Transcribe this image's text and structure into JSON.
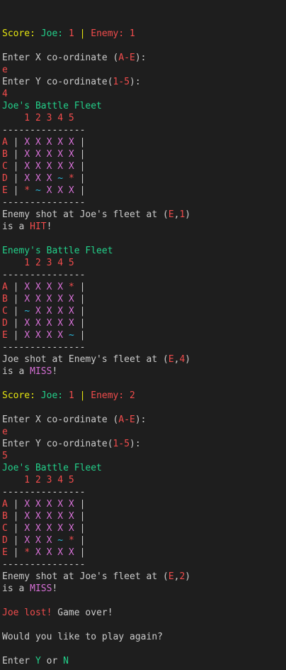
{
  "colors": {
    "default": "#cccccc",
    "yellow": "#e5e510",
    "green": "#23d18b",
    "red": "#f14c4c",
    "magenta": "#d670d6",
    "cyan": "#29b8db",
    "background": "#1e1e1e"
  },
  "lines": [
    [
      [
        "Score: ",
        "yellow"
      ],
      [
        "Joe: ",
        "green"
      ],
      [
        "1",
        "red"
      ],
      [
        " | ",
        "yellow"
      ],
      [
        "Enemy: ",
        "red"
      ],
      [
        "1",
        "red"
      ]
    ],
    [],
    [
      [
        "Enter X co-ordinate (",
        "default"
      ],
      [
        "A-E",
        "red"
      ],
      [
        "):",
        "default"
      ]
    ],
    [
      [
        "e",
        "red"
      ]
    ],
    [
      [
        "Enter Y co-ordinate(",
        "default"
      ],
      [
        "1-5",
        "red"
      ],
      [
        "):",
        "default"
      ]
    ],
    [
      [
        "4",
        "red"
      ]
    ],
    [
      [
        "Joe's Battle Fleet",
        "green"
      ]
    ],
    [
      [
        "    1 2 3 4 5",
        "red"
      ]
    ],
    [
      [
        "---------------",
        "default"
      ]
    ],
    [
      [
        "A",
        "red"
      ],
      [
        " | ",
        "default"
      ],
      [
        "X X X X X",
        "magenta"
      ],
      [
        " |",
        "default"
      ]
    ],
    [
      [
        "B",
        "red"
      ],
      [
        " | ",
        "default"
      ],
      [
        "X X X X X",
        "magenta"
      ],
      [
        " |",
        "default"
      ]
    ],
    [
      [
        "C",
        "red"
      ],
      [
        " | ",
        "default"
      ],
      [
        "X X X X X",
        "magenta"
      ],
      [
        " |",
        "default"
      ]
    ],
    [
      [
        "D",
        "red"
      ],
      [
        " | ",
        "default"
      ],
      [
        "X X X ",
        "magenta"
      ],
      [
        "~",
        "cyan"
      ],
      [
        " ",
        "default"
      ],
      [
        "*",
        "red"
      ],
      [
        " |",
        "default"
      ]
    ],
    [
      [
        "E",
        "red"
      ],
      [
        " | ",
        "default"
      ],
      [
        "*",
        "red"
      ],
      [
        " ",
        "default"
      ],
      [
        "~",
        "cyan"
      ],
      [
        " X X X",
        "magenta"
      ],
      [
        " |",
        "default"
      ]
    ],
    [
      [
        "---------------",
        "default"
      ]
    ],
    [
      [
        "Enemy shot at Joe's fleet at (",
        "default"
      ],
      [
        "E",
        "red"
      ],
      [
        ",",
        "default"
      ],
      [
        "1",
        "red"
      ],
      [
        ")",
        "default"
      ]
    ],
    [
      [
        "is a ",
        "default"
      ],
      [
        "HIT",
        "red"
      ],
      [
        "!",
        "default"
      ]
    ],
    [],
    [
      [
        "Enemy's Battle Fleet",
        "green"
      ]
    ],
    [
      [
        "    1 2 3 4 5",
        "red"
      ]
    ],
    [
      [
        "---------------",
        "default"
      ]
    ],
    [
      [
        "A",
        "red"
      ],
      [
        " | ",
        "default"
      ],
      [
        "X X X X ",
        "magenta"
      ],
      [
        "*",
        "red"
      ],
      [
        " |",
        "default"
      ]
    ],
    [
      [
        "B",
        "red"
      ],
      [
        " | ",
        "default"
      ],
      [
        "X X X X X",
        "magenta"
      ],
      [
        " |",
        "default"
      ]
    ],
    [
      [
        "C",
        "red"
      ],
      [
        " | ",
        "default"
      ],
      [
        "~",
        "cyan"
      ],
      [
        " X X X X",
        "magenta"
      ],
      [
        " |",
        "default"
      ]
    ],
    [
      [
        "D",
        "red"
      ],
      [
        " | ",
        "default"
      ],
      [
        "X X X X X",
        "magenta"
      ],
      [
        " |",
        "default"
      ]
    ],
    [
      [
        "E",
        "red"
      ],
      [
        " | ",
        "default"
      ],
      [
        "X X X X ",
        "magenta"
      ],
      [
        "~",
        "cyan"
      ],
      [
        " |",
        "default"
      ]
    ],
    [
      [
        "---------------",
        "default"
      ]
    ],
    [
      [
        "Joe shot at Enemy's fleet at (",
        "default"
      ],
      [
        "E",
        "red"
      ],
      [
        ",",
        "default"
      ],
      [
        "4",
        "red"
      ],
      [
        ")",
        "default"
      ]
    ],
    [
      [
        "is a ",
        "default"
      ],
      [
        "MISS",
        "magenta"
      ],
      [
        "!",
        "default"
      ]
    ],
    [],
    [
      [
        "Score: ",
        "yellow"
      ],
      [
        "Joe: ",
        "green"
      ],
      [
        "1",
        "red"
      ],
      [
        " | ",
        "yellow"
      ],
      [
        "Enemy: ",
        "red"
      ],
      [
        "2",
        "red"
      ]
    ],
    [],
    [
      [
        "Enter X co-ordinate (",
        "default"
      ],
      [
        "A-E",
        "red"
      ],
      [
        "):",
        "default"
      ]
    ],
    [
      [
        "e",
        "red"
      ]
    ],
    [
      [
        "Enter Y co-ordinate(",
        "default"
      ],
      [
        "1-5",
        "red"
      ],
      [
        "):",
        "default"
      ]
    ],
    [
      [
        "5",
        "red"
      ]
    ],
    [
      [
        "Joe's Battle Fleet",
        "green"
      ]
    ],
    [
      [
        "    1 2 3 4 5",
        "red"
      ]
    ],
    [
      [
        "---------------",
        "default"
      ]
    ],
    [
      [
        "A",
        "red"
      ],
      [
        " | ",
        "default"
      ],
      [
        "X X X X X",
        "magenta"
      ],
      [
        " |",
        "default"
      ]
    ],
    [
      [
        "B",
        "red"
      ],
      [
        " | ",
        "default"
      ],
      [
        "X X X X X",
        "magenta"
      ],
      [
        " |",
        "default"
      ]
    ],
    [
      [
        "C",
        "red"
      ],
      [
        " | ",
        "default"
      ],
      [
        "X X X X X",
        "magenta"
      ],
      [
        " |",
        "default"
      ]
    ],
    [
      [
        "D",
        "red"
      ],
      [
        " | ",
        "default"
      ],
      [
        "X X X ",
        "magenta"
      ],
      [
        "~",
        "cyan"
      ],
      [
        " ",
        "default"
      ],
      [
        "*",
        "red"
      ],
      [
        " |",
        "default"
      ]
    ],
    [
      [
        "E",
        "red"
      ],
      [
        " | ",
        "default"
      ],
      [
        "*",
        "red"
      ],
      [
        " X X X X",
        "magenta"
      ],
      [
        " |",
        "default"
      ]
    ],
    [
      [
        "---------------",
        "default"
      ]
    ],
    [
      [
        "Enemy shot at Joe's fleet at (",
        "default"
      ],
      [
        "E",
        "red"
      ],
      [
        ",",
        "default"
      ],
      [
        "2",
        "red"
      ],
      [
        ")",
        "default"
      ]
    ],
    [
      [
        "is a ",
        "default"
      ],
      [
        "MISS",
        "magenta"
      ],
      [
        "!",
        "default"
      ]
    ],
    [],
    [
      [
        "Joe lost!",
        "red"
      ],
      [
        " Game over!",
        "default"
      ]
    ],
    [],
    [
      [
        "Would you like to play again?",
        "default"
      ]
    ],
    [],
    [
      [
        "Enter ",
        "default"
      ],
      [
        "Y",
        "green"
      ],
      [
        " or ",
        "default"
      ],
      [
        "N",
        "green"
      ]
    ]
  ]
}
